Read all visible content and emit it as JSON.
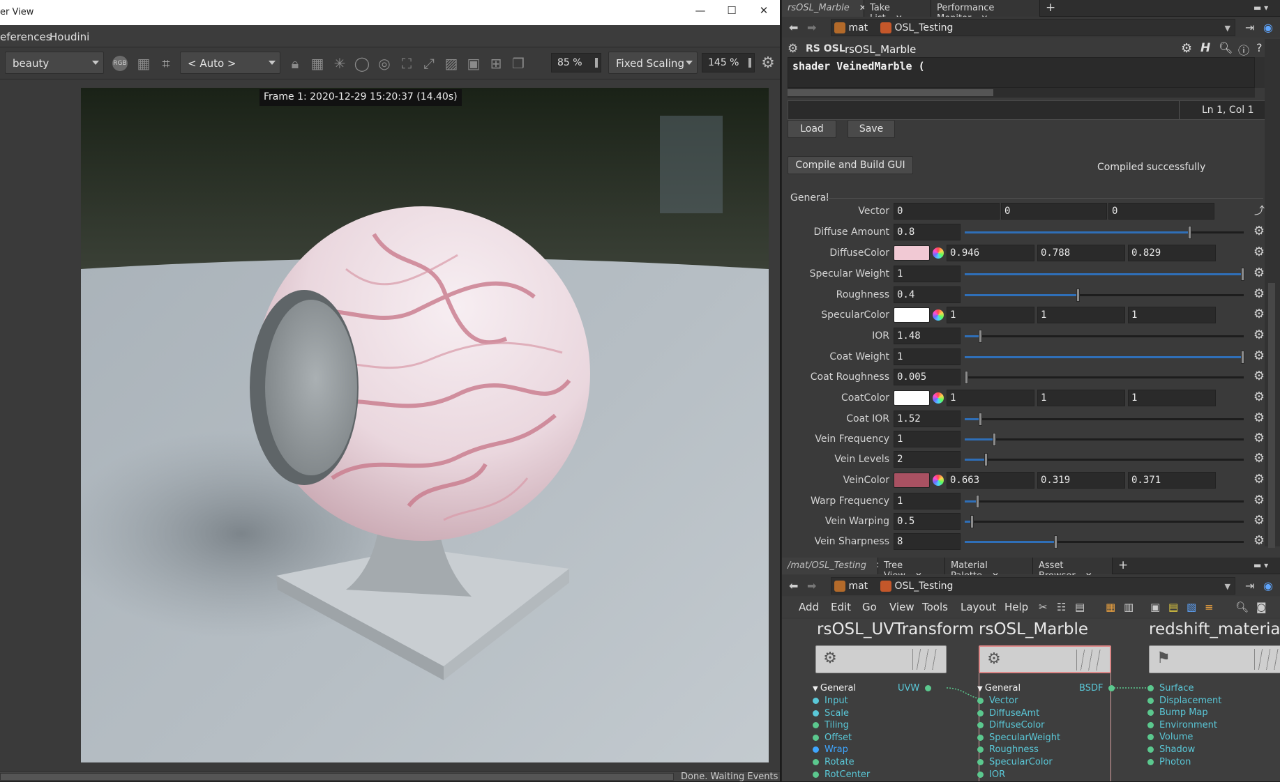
{
  "render_view": {
    "window_title": "er View",
    "menu": [
      "eferences",
      "Houdini"
    ],
    "toolbar": {
      "aov": "beauty",
      "camera": "< Auto >",
      "zoom": "85 %",
      "scaling": "Fixed Scaling",
      "scaling_value": "145 %",
      "rgb_label": "RGB"
    },
    "frame_label": "Frame  1:  2020-12-29  15:20:37  (14.40s)",
    "status": "Done. Waiting Events"
  },
  "param_editor": {
    "tabs": [
      {
        "label": "rsOSL_Marble",
        "active": true
      },
      {
        "label": "Take List"
      },
      {
        "label": "Performance Monitor"
      }
    ],
    "path": [
      "mat",
      "OSL_Testing"
    ],
    "node_type": "RS OSL",
    "node_name": "rsOSL_Marble",
    "code": "shader VeinedMarble (",
    "cursor_pos": "Ln 1, Col 1",
    "load_label": "Load",
    "save_label": "Save",
    "compile_label": "Compile and Build GUI",
    "compile_status": "Compiled successfully",
    "section": "General",
    "params": [
      {
        "label": "Vector",
        "type": "vec",
        "values": [
          "0",
          "0",
          "0"
        ]
      },
      {
        "label": "Diffuse Amount",
        "type": "float",
        "value": "0.8",
        "fraction": 0.8
      },
      {
        "label": "DiffuseColor",
        "type": "color",
        "color": "#f1c9d4",
        "values": [
          "0.946",
          "0.788",
          "0.829"
        ]
      },
      {
        "label": "Specular Weight",
        "type": "float",
        "value": "1",
        "fraction": 1.0
      },
      {
        "label": "Roughness",
        "type": "float",
        "value": "0.4",
        "fraction": 0.4
      },
      {
        "label": "SpecularColor",
        "type": "color",
        "color": "#ffffff",
        "values": [
          "1",
          "1",
          "1"
        ]
      },
      {
        "label": "IOR",
        "type": "float",
        "value": "1.48",
        "fraction": 0.05
      },
      {
        "label": "Coat Weight",
        "type": "float",
        "value": "1",
        "fraction": 1.0
      },
      {
        "label": "Coat Roughness",
        "type": "float",
        "value": "0.005",
        "fraction": 0.0
      },
      {
        "label": "CoatColor",
        "type": "color",
        "color": "#ffffff",
        "values": [
          "1",
          "1",
          "1"
        ]
      },
      {
        "label": "Coat IOR",
        "type": "float",
        "value": "1.52",
        "fraction": 0.05
      },
      {
        "label": "Vein Frequency",
        "type": "float",
        "value": "1",
        "fraction": 0.1
      },
      {
        "label": "Vein Levels",
        "type": "float",
        "value": "2",
        "fraction": 0.07
      },
      {
        "label": "VeinColor",
        "type": "color",
        "color": "#a95162",
        "values": [
          "0.663",
          "0.319",
          "0.371"
        ]
      },
      {
        "label": "Warp Frequency",
        "type": "float",
        "value": "1",
        "fraction": 0.04
      },
      {
        "label": "Vein Warping",
        "type": "float",
        "value": "0.5",
        "fraction": 0.02
      },
      {
        "label": "Vein Sharpness",
        "type": "float",
        "value": "8",
        "fraction": 0.32
      }
    ]
  },
  "network_editor": {
    "tabs": [
      {
        "label": "/mat/OSL_Testing",
        "active": true
      },
      {
        "label": "Tree View"
      },
      {
        "label": "Material Palette"
      },
      {
        "label": "Asset Browser"
      }
    ],
    "path": [
      "mat",
      "OSL_Testing"
    ],
    "menu": [
      "Add",
      "Edit",
      "Go",
      "View",
      "Tools",
      "Layout",
      "Help"
    ],
    "nodes": [
      {
        "title": "rsOSL_UVTransform",
        "header": "General",
        "output": "UVW",
        "inputs": [
          "Input",
          "Scale",
          "Tiling",
          "Offset",
          "Wrap",
          "Rotate",
          "RotCenter"
        ]
      },
      {
        "title": "rsOSL_Marble",
        "header": "General",
        "output": "BSDF",
        "inputs": [
          "Vector",
          "DiffuseAmt",
          "DiffuseColor",
          "SpecularWeight",
          "Roughness",
          "SpecularColor",
          "IOR"
        ]
      },
      {
        "title": "redshift_material",
        "inputs": [
          "Surface",
          "Displacement",
          "Bump Map",
          "Environment",
          "Volume",
          "Shadow",
          "Photon"
        ]
      }
    ]
  }
}
